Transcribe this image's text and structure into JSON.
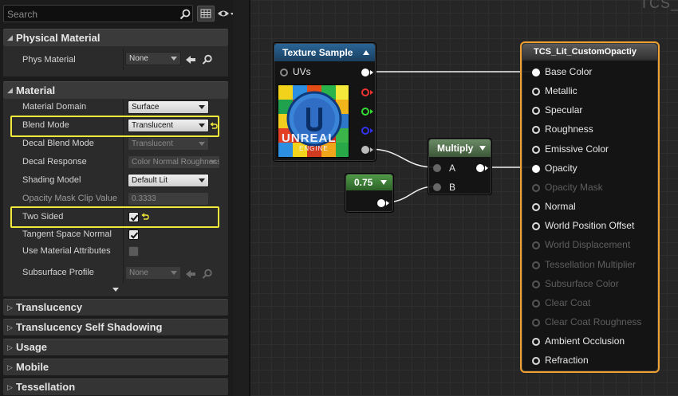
{
  "search": {
    "placeholder": "Search"
  },
  "physical_material": {
    "title": "Physical Material",
    "phys_material_label": "Phys Material",
    "phys_material_value": "None"
  },
  "material": {
    "title": "Material",
    "rows": [
      {
        "label": "Material Domain",
        "value": "Surface",
        "kind": "combo"
      },
      {
        "label": "Blend Mode",
        "value": "Translucent",
        "kind": "combo"
      },
      {
        "label": "Decal Blend Mode",
        "value": "Translucent",
        "kind": "combo-disabled"
      },
      {
        "label": "Decal Response",
        "value": "Color Normal Roughness",
        "kind": "combo-disabled"
      },
      {
        "label": "Shading Model",
        "value": "Default Lit",
        "kind": "combo"
      },
      {
        "label": "Opacity Mask Clip Value",
        "value": "0.3333",
        "kind": "number-disabled"
      },
      {
        "label": "Two Sided",
        "checked": true,
        "kind": "checkbox"
      },
      {
        "label": "Tangent Space Normal",
        "checked": true,
        "kind": "checkbox"
      },
      {
        "label": "Use Material Attributes",
        "checked": false,
        "kind": "checkbox"
      },
      {
        "label": "Subsurface Profile",
        "value": "None",
        "kind": "asset-disabled"
      }
    ]
  },
  "collapsed_categories": [
    "Translucency",
    "Translucency Self Shadowing",
    "Usage",
    "Mobile",
    "Tessellation"
  ],
  "graph": {
    "title_partial": "TCS_L",
    "texture_sample": {
      "title": "Texture Sample",
      "input": "UVs",
      "preview_text": "UNREAL",
      "preview_subtext": "ENGINE"
    },
    "constant": {
      "value": "0.75"
    },
    "multiply": {
      "title": "Multiply",
      "a": "A",
      "b": "B"
    },
    "result": {
      "title": "TCS_Lit_CustomOpactiy",
      "pins": [
        {
          "label": "Base Color",
          "enabled": true,
          "connected": true
        },
        {
          "label": "Metallic",
          "enabled": true,
          "connected": false
        },
        {
          "label": "Specular",
          "enabled": true,
          "connected": false
        },
        {
          "label": "Roughness",
          "enabled": true,
          "connected": false
        },
        {
          "label": "Emissive Color",
          "enabled": true,
          "connected": false
        },
        {
          "label": "Opacity",
          "enabled": true,
          "connected": true
        },
        {
          "label": "Opacity Mask",
          "enabled": false,
          "connected": false
        },
        {
          "label": "Normal",
          "enabled": true,
          "connected": false
        },
        {
          "label": "World Position Offset",
          "enabled": true,
          "connected": false
        },
        {
          "label": "World Displacement",
          "enabled": false,
          "connected": false
        },
        {
          "label": "Tessellation Multiplier",
          "enabled": false,
          "connected": false
        },
        {
          "label": "Subsurface Color",
          "enabled": false,
          "connected": false
        },
        {
          "label": "Clear Coat",
          "enabled": false,
          "connected": false
        },
        {
          "label": "Clear Coat Roughness",
          "enabled": false,
          "connected": false
        },
        {
          "label": "Ambient Occlusion",
          "enabled": true,
          "connected": false
        },
        {
          "label": "Refraction",
          "enabled": true,
          "connected": false
        }
      ]
    }
  },
  "colors": {
    "highlight": "#f2ea3a",
    "result_border": "#f0a030",
    "texture_header": "#1f4f78",
    "multiply_header": "#4d6a4a",
    "constant_header": "#3f7a3a"
  }
}
